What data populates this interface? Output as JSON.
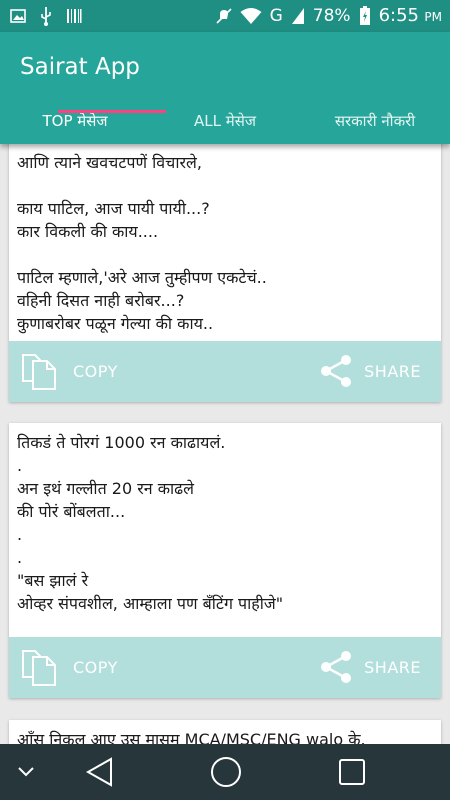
{
  "status_bar": {
    "battery": "78%",
    "network": "G",
    "time": "6:55",
    "ampm": "PM"
  },
  "app": {
    "title": "Sairat App"
  },
  "tabs": [
    {
      "label": "TOP मेसेज",
      "active": true
    },
    {
      "label": "ALL मेसेज",
      "active": false
    },
    {
      "label": "सरकारी नौकरी",
      "active": false
    }
  ],
  "cards": [
    {
      "text": "आणि त्याने खवचटपणें विचारले,\n\nकाय पाटिल, आज पायी पायी...?\nकार विकली की काय....\n\nपाटिल म्हणाले,'अरे आज तुम्हीपण एकटेचं..\nवहिनी दिसत नाही बरोबर...?\nकुणाबरोबर पळून गेल्या की काय..",
      "copy_label": "COPY",
      "share_label": "SHARE"
    },
    {
      "text": "तिकडं ते पोरगं 1000 रन काढायलं.\n.\nअन इथं गल्लीत 20 रन काढले\nकी पोरं बोंबलता...\n.\n.\n\"बस झालं रे\nओव्हर संपवशील, आम्हाला पण बँटिंग पाहीजे\"",
      "copy_label": "COPY",
      "share_label": "SHARE"
    },
    {
      "text": "आँस निकल आए उस मासम MCA/MSC/ENG walo के."
    }
  ],
  "colors": {
    "status_bar": "#1f8f83",
    "app_bar": "#26a69a",
    "tab_indicator": "#ff4081",
    "action_bar": "#b2dfdb",
    "nav_bar": "#26363b"
  },
  "icons": {
    "status_left": [
      "image-icon",
      "usb-icon",
      "barcode-icon"
    ],
    "status_right": [
      "mute-icon",
      "wifi-icon",
      "signal-icon",
      "battery-icon"
    ],
    "card_actions": [
      "copy-icon",
      "share-icon"
    ],
    "nav": [
      "chevron-down-icon",
      "back-icon",
      "home-icon",
      "recents-icon"
    ]
  }
}
